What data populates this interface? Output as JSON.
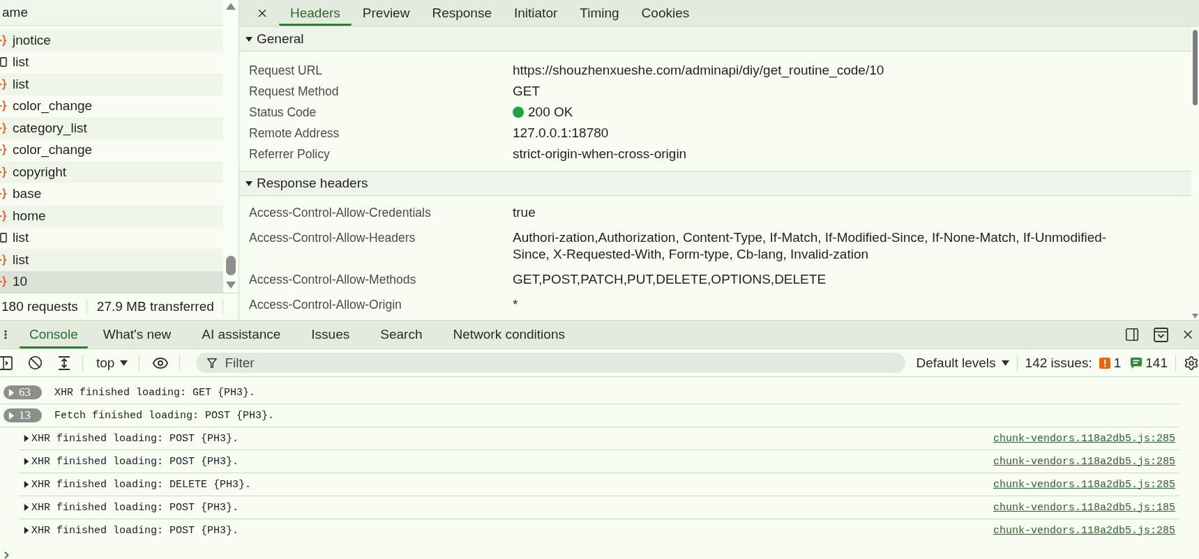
{
  "network_list": {
    "header": "ame",
    "rows": [
      {
        "kind": "fetch",
        "name": "jnotice",
        "selected": false
      },
      {
        "kind": "document",
        "name": "list",
        "selected": false
      },
      {
        "kind": "fetch",
        "name": "list",
        "selected": false
      },
      {
        "kind": "fetch",
        "name": "color_change",
        "selected": false
      },
      {
        "kind": "fetch",
        "name": "category_list",
        "selected": false
      },
      {
        "kind": "fetch",
        "name": "color_change",
        "selected": false
      },
      {
        "kind": "fetch",
        "name": "copyright",
        "selected": false
      },
      {
        "kind": "fetch",
        "name": "base",
        "selected": false
      },
      {
        "kind": "fetch",
        "name": "home",
        "selected": false
      },
      {
        "kind": "document",
        "name": "list",
        "selected": false
      },
      {
        "kind": "fetch",
        "name": "list",
        "selected": false
      },
      {
        "kind": "fetch",
        "name": "10",
        "selected": true
      }
    ]
  },
  "network_summary": {
    "requests": "180 requests",
    "transferred": "27.9 MB transferred"
  },
  "detail_tabs": [
    {
      "label": "Headers",
      "selected": true
    },
    {
      "label": "Preview",
      "selected": false
    },
    {
      "label": "Response",
      "selected": false
    },
    {
      "label": "Initiator",
      "selected": false
    },
    {
      "label": "Timing",
      "selected": false
    },
    {
      "label": "Cookies",
      "selected": false
    }
  ],
  "sections": [
    {
      "title": "General",
      "expanded": true,
      "rows": [
        {
          "kind": "text",
          "name": "Request URL",
          "value": "https://shouzhenxueshe.com/adminapi/diy/get_routine_code/10"
        },
        {
          "kind": "text",
          "name": "Request Method",
          "value": "GET"
        },
        {
          "kind": "status",
          "name": "Status Code",
          "value": "200 OK"
        },
        {
          "kind": "text",
          "name": "Remote Address",
          "value": "127.0.0.1:18780"
        },
        {
          "kind": "text",
          "name": "Referrer Policy",
          "value": "strict-origin-when-cross-origin"
        }
      ]
    },
    {
      "title": "Response headers",
      "expanded": true,
      "rows": [
        {
          "kind": "text",
          "name": "Access-Control-Allow-Credentials",
          "value": "true"
        },
        {
          "kind": "text",
          "name": "Access-Control-Allow-Headers",
          "value": "Authori-zation,Authorization, Content-Type, If-Match, If-Modified-Since, If-None-Match, If-Unmodified-Since, X-Requested-With, Form-type, Cb-lang, Invalid-zation"
        },
        {
          "kind": "text",
          "name": "Access-Control-Allow-Methods",
          "value": "GET,POST,PATCH,PUT,DELETE,OPTIONS,DELETE"
        },
        {
          "kind": "text",
          "name": "Access-Control-Allow-Origin",
          "value": "*"
        }
      ]
    }
  ],
  "drawer_tabs": [
    {
      "label": "Console",
      "selected": true
    },
    {
      "label": "What's new",
      "selected": false
    },
    {
      "label": "AI assistance",
      "selected": false
    },
    {
      "label": "Issues",
      "selected": false
    },
    {
      "label": "Search",
      "selected": false
    },
    {
      "label": "Network conditions",
      "selected": false
    }
  ],
  "console_toolbar": {
    "context": "top",
    "filter_placeholder": "Filter",
    "levels": "Default levels",
    "issues_label": "142 issues:",
    "issue_counts": [
      {
        "kind": "warning",
        "count": "1"
      },
      {
        "kind": "info",
        "count": "141"
      }
    ]
  },
  "console_messages": [
    {
      "kind": "group",
      "count": "63",
      "text": "XHR finished loading: GET {PH3}."
    },
    {
      "kind": "group",
      "count": "13",
      "text": "Fetch finished loading: POST {PH3}."
    },
    {
      "kind": "entry",
      "text": "XHR finished loading: POST {PH3}.",
      "source": "chunk-vendors.118a2db5.js:285"
    },
    {
      "kind": "entry",
      "text": "XHR finished loading: POST {PH3}.",
      "source": "chunk-vendors.118a2db5.js:285"
    },
    {
      "kind": "entry",
      "text": "XHR finished loading: DELETE {PH3}.",
      "source": "chunk-vendors.118a2db5.js:285"
    },
    {
      "kind": "entry",
      "text": "XHR finished loading: POST {PH3}.",
      "source": "chunk-vendors.118a2db5.js:185"
    },
    {
      "kind": "entry",
      "text": "XHR finished loading: POST {PH3}.",
      "source": "chunk-vendors.118a2db5.js:285"
    }
  ]
}
